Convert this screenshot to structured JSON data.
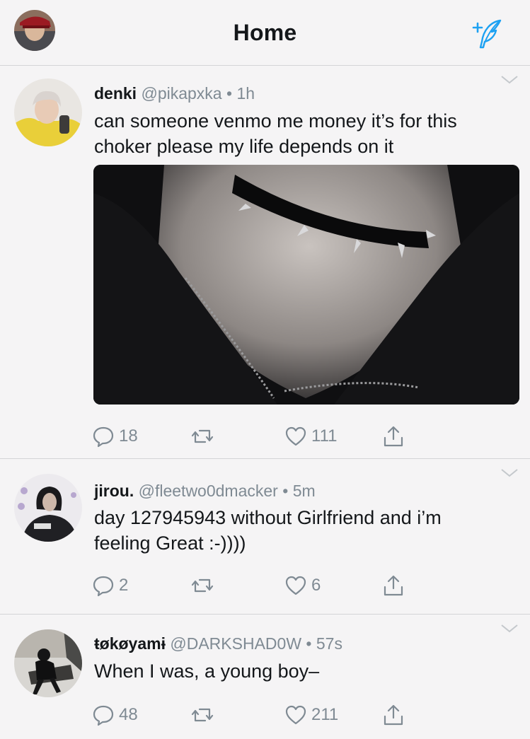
{
  "header": {
    "title": "Home",
    "accent": "#1da1f2",
    "compose_icon": "compose-feather-icon"
  },
  "colors": {
    "background": "#f5f4f5",
    "divider": "#d4d4d6",
    "secondary_text": "#7f8a93"
  },
  "tweets": [
    {
      "name": "denki",
      "handle": "@pikapxka",
      "time": "1h",
      "text_lines": [
        "can someone venmo me money it’s for this",
        "choker please my life depends on it"
      ],
      "has_media": true,
      "replies": "18",
      "likes": "111"
    },
    {
      "name": "jirou.",
      "handle": "@fleetwo0dmacker",
      "time": "5m",
      "text_lines": [
        "day 127945943 without Girlfriend and i’m",
        "feeling Great :-))))"
      ],
      "has_media": false,
      "replies": "2",
      "likes": "6"
    },
    {
      "name": "ŧøkøyamɨ",
      "handle": "@DARKSHAD0W",
      "time": "57s",
      "text_lines": [
        "When I was, a young boy–"
      ],
      "has_media": false,
      "replies": "48",
      "likes": "211"
    }
  ],
  "separator": "•",
  "icons": [
    "reply-icon",
    "retweet-icon",
    "like-icon",
    "share-icon",
    "chevron-down-icon"
  ]
}
